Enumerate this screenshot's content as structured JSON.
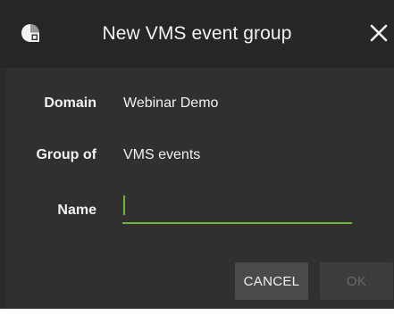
{
  "dialog": {
    "title": "New VMS event group",
    "app_icon": "app-logo-icon",
    "close_icon": "close-icon"
  },
  "fields": {
    "domain": {
      "label": "Domain",
      "value": "Webinar Demo"
    },
    "group_of": {
      "label": "Group of",
      "value": "VMS events"
    },
    "name": {
      "label": "Name",
      "value": "",
      "placeholder": ""
    }
  },
  "buttons": {
    "cancel_label": "CANCEL",
    "ok_label": "OK",
    "ok_enabled": false
  },
  "colors": {
    "accent": "#72b33a",
    "background": "#303030",
    "header": "#262626",
    "text": "#f2f2f2"
  }
}
